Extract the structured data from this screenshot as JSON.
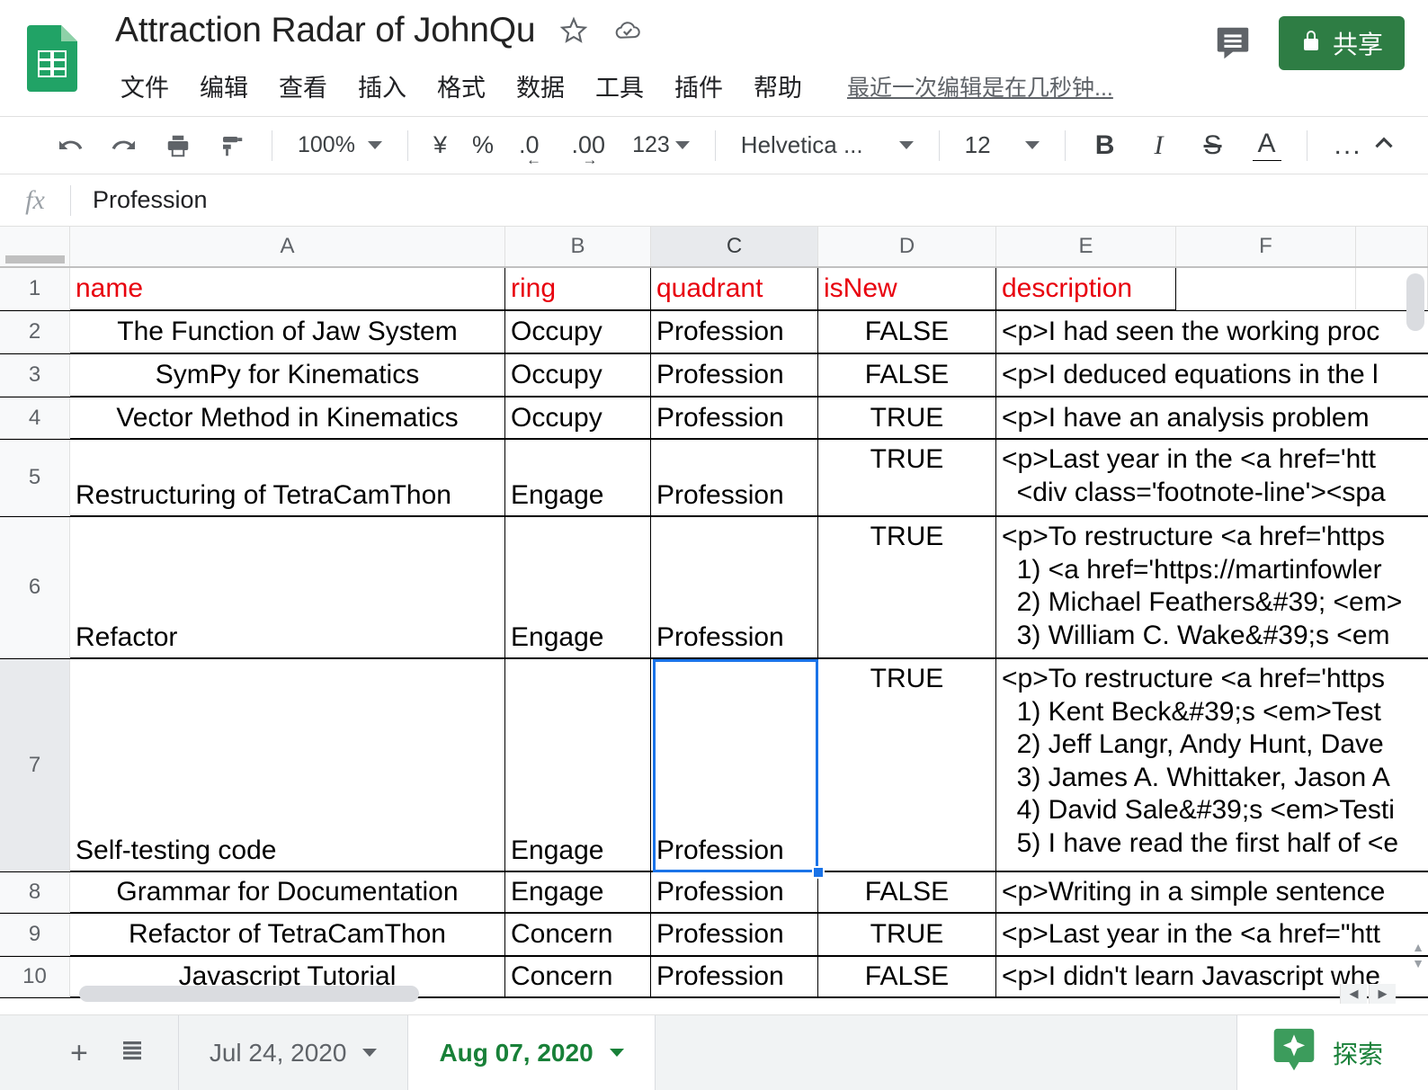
{
  "header": {
    "app_icon": "sheets-icon",
    "doc_title": "Attraction Radar of JohnQu",
    "star_icon": "star-icon",
    "cloud_icon": "cloud-saved-icon",
    "menus": [
      "文件",
      "编辑",
      "查看",
      "插入",
      "格式",
      "数据",
      "工具",
      "插件",
      "帮助"
    ],
    "last_edit": "最近一次编辑是在几秒钟...",
    "comment_icon": "comment-icon",
    "share_label": "共享",
    "share_lock_icon": "lock-icon",
    "share_color": "#2e7d44"
  },
  "toolbar": {
    "undo_icon": "undo-icon",
    "redo_icon": "redo-icon",
    "print_icon": "print-icon",
    "paint_format_icon": "paint-format-icon",
    "zoom": "100%",
    "currency_icon": "¥",
    "percent_icon": "%",
    "decrease_decimal": ".0",
    "increase_decimal": ".00",
    "number_format": "123",
    "font_family": "Helvetica ...",
    "font_size": "12",
    "bold": "B",
    "italic": "I",
    "strikethrough": "S",
    "text_color": "A",
    "text_color_swatch": "#000000",
    "more_label": "...",
    "collapse_icon": "chevron-up-icon"
  },
  "formula_bar": {
    "fx_label": "fx",
    "value": "Profession",
    "placeholder": ""
  },
  "grid": {
    "columns": [
      "A",
      "B",
      "C",
      "D",
      "E",
      "F"
    ],
    "selected_column": "C",
    "selected_row": "7",
    "selected_cell": "C7",
    "row_numbers": [
      "1",
      "2",
      "3",
      "4",
      "5",
      "6",
      "7",
      "8",
      "9",
      "10"
    ],
    "header_color": "#e8000d",
    "selection_color": "#1a73e8",
    "rows": [
      {
        "num": "1",
        "name": "name",
        "ring": "ring",
        "quadrant": "quadrant",
        "isNew": "isNew",
        "description": "description"
      },
      {
        "num": "2",
        "name": "The Function of Jaw System",
        "ring": "Occupy",
        "quadrant": "Profession",
        "isNew": "FALSE",
        "description": "<p>I had seen the working proc"
      },
      {
        "num": "3",
        "name": "SymPy for Kinematics",
        "ring": "Occupy",
        "quadrant": "Profession",
        "isNew": "FALSE",
        "description": "<p>I deduced equations in the l"
      },
      {
        "num": "4",
        "name": "Vector Method in Kinematics",
        "ring": "Occupy",
        "quadrant": "Profession",
        "isNew": "TRUE",
        "description": "<p>I have an analysis problem "
      },
      {
        "num": "5",
        "name": "Restructuring of TetraCamThon",
        "ring": "Engage",
        "quadrant": "Profession",
        "isNew": "TRUE",
        "description": "<p>Last year in the <a href='htt\n  <div class='footnote-line'><spa"
      },
      {
        "num": "6",
        "name": "Refactor",
        "ring": "Engage",
        "quadrant": "Profession",
        "isNew": "TRUE",
        "description": "<p>To restructure <a href='https\n  1) <a href='https://martinfowler\n  2) Michael Feathers&#39; <em>\n  3) William C. Wake&#39;s <em"
      },
      {
        "num": "7",
        "name": "Self-testing code",
        "ring": "Engage",
        "quadrant": "Profession",
        "isNew": "TRUE",
        "description": "<p>To restructure <a href='https\n  1) Kent Beck&#39;s <em>Test\n  2) Jeff Langr, Andy Hunt, Dave\n  3) James A. Whittaker, Jason A\n  4) David Sale&#39;s <em>Testi\n  5) I have read the first half of <e"
      },
      {
        "num": "8",
        "name": "Grammar for Documentation",
        "ring": "Engage",
        "quadrant": "Profession",
        "isNew": "FALSE",
        "description": "<p>Writing in a simple sentence"
      },
      {
        "num": "9",
        "name": "Refactor of TetraCamThon",
        "ring": "Concern",
        "quadrant": "Profession",
        "isNew": "TRUE",
        "description": "<p>Last year in the <a href=\"htt"
      },
      {
        "num": "10",
        "name": "Javascript Tutorial",
        "ring": "Concern",
        "quadrant": "Profession",
        "isNew": "FALSE",
        "description": "<p>I didn't learn Javascript whe"
      }
    ]
  },
  "sheetbar": {
    "add_sheet_icon": "plus-icon",
    "all_sheets_icon": "list-icon",
    "tabs": [
      {
        "label": "Jul 24, 2020",
        "active": false
      },
      {
        "label": "Aug 07, 2020",
        "active": true
      }
    ],
    "explore_label": "探索",
    "explore_icon": "explore-sparkle-icon",
    "explore_color": "#188038"
  }
}
